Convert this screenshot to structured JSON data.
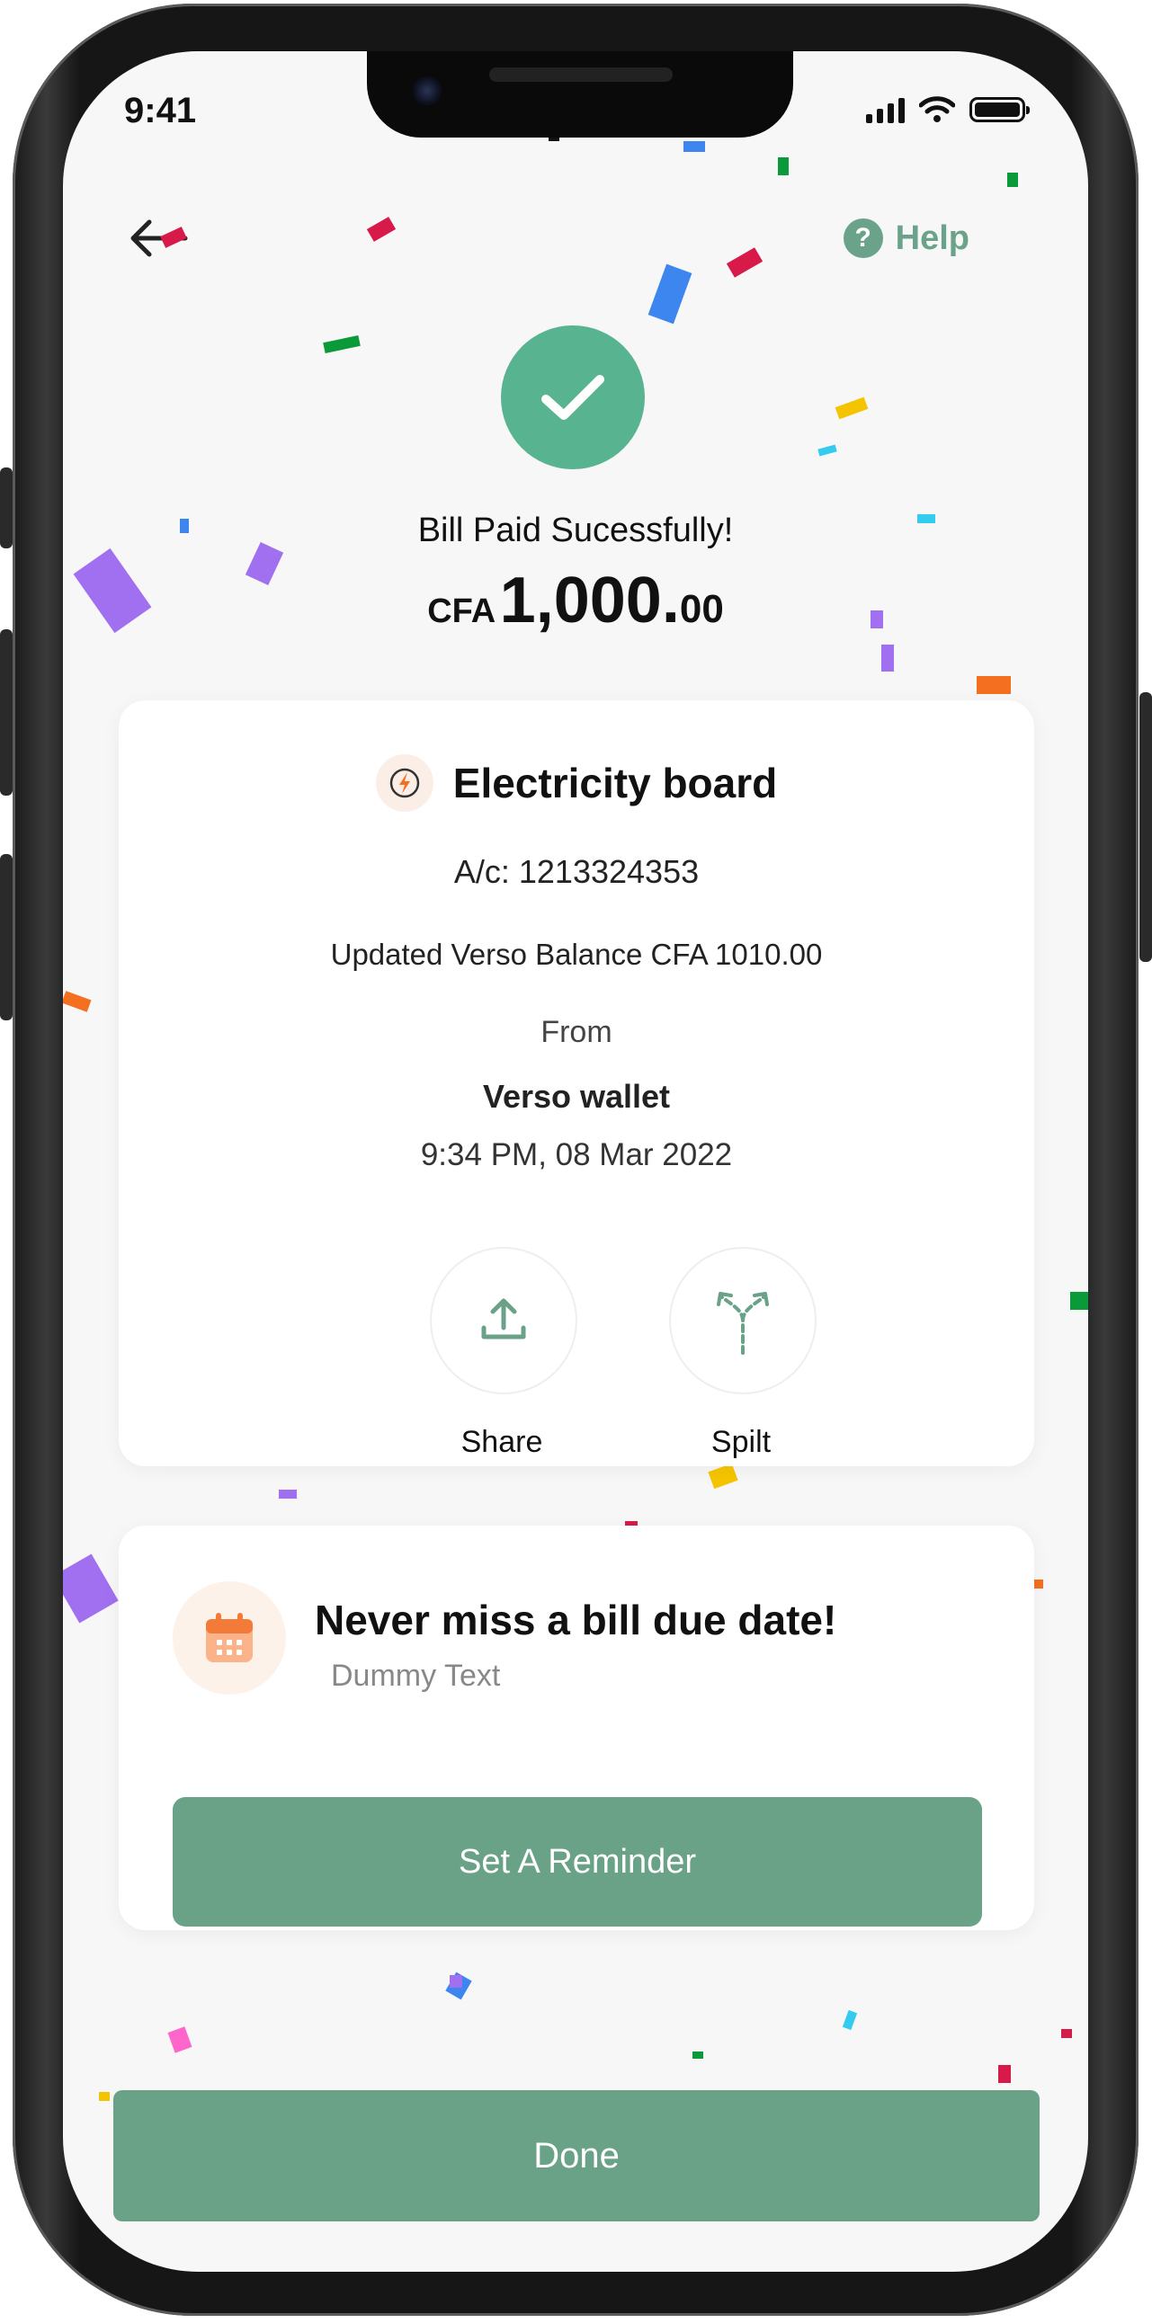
{
  "status_bar": {
    "time": "9:41"
  },
  "header": {
    "help_label": "Help",
    "help_icon": "question-icon",
    "back_icon": "arrow-left-icon"
  },
  "success": {
    "title": "Bill Paid Sucessfully!",
    "currency": "CFA",
    "amount_main": "1,000.",
    "amount_decimals": "00"
  },
  "details": {
    "biller_name": "Electricity board",
    "account": "A/c: 1213324353",
    "updated_balance": "Updated Verso Balance CFA 1010.00",
    "from_label": "From",
    "wallet": "Verso wallet",
    "timestamp": "9:34 PM, 08 Mar 2022",
    "actions": [
      {
        "label": "Share",
        "icon": "share-upload-icon"
      },
      {
        "label": "Spilt",
        "icon": "split-arrows-icon"
      }
    ]
  },
  "reminder": {
    "title": "Never miss a bill due date!",
    "subtitle": "Dummy Text",
    "button_label": "Set A Reminder",
    "icon": "calendar-icon"
  },
  "footer": {
    "done_label": "Done"
  },
  "colors": {
    "accent": "#6aa288",
    "success": "#58b490",
    "help": "#6aa38a"
  }
}
